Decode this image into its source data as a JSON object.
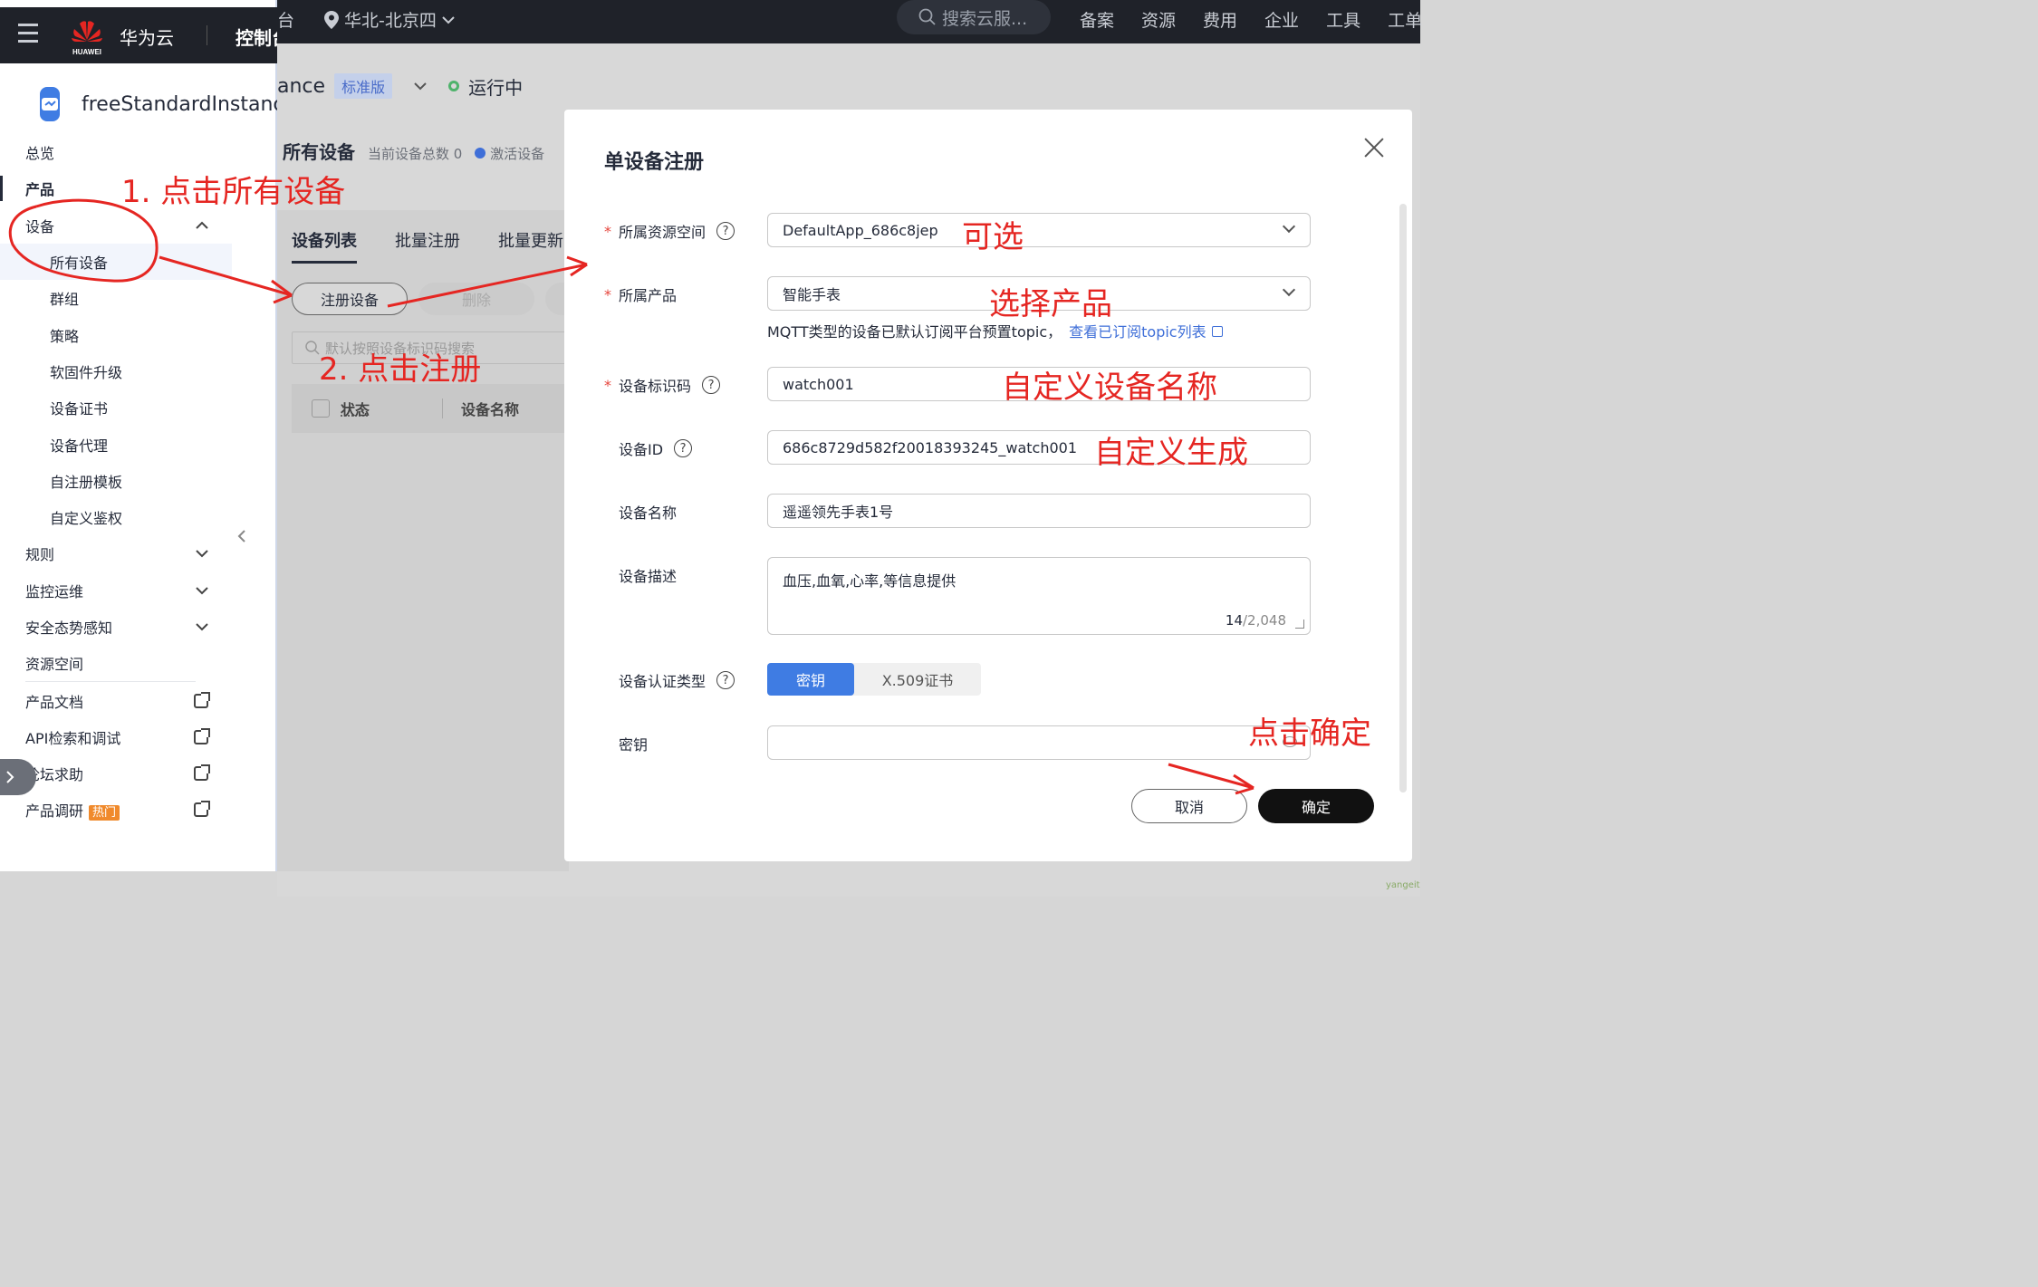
{
  "topbar": {
    "partial_left": "台",
    "region": "华北-北京四",
    "search_placeholder": "搜索云服...",
    "nav": [
      "备案",
      "资源",
      "费用",
      "企业",
      "工具",
      "工单"
    ]
  },
  "left_panel": {
    "brand": "华为云",
    "logo_text": "HUAWEI",
    "console": "控制台",
    "instance_name": "freeStandardInstance",
    "menu": [
      {
        "label": "总览"
      },
      {
        "label": "产品"
      },
      {
        "label": "设备"
      },
      {
        "label": "所有设备"
      },
      {
        "label": "群组"
      },
      {
        "label": "策略"
      },
      {
        "label": "软固件升级"
      },
      {
        "label": "设备证书"
      },
      {
        "label": "设备代理"
      },
      {
        "label": "自注册模板"
      },
      {
        "label": "自定义鉴权"
      },
      {
        "label": "规则"
      },
      {
        "label": "监控运维"
      },
      {
        "label": "安全态势感知"
      },
      {
        "label": "资源空间"
      },
      {
        "label": "产品文档"
      },
      {
        "label": "API检索和调试"
      },
      {
        "label": "论坛求助"
      },
      {
        "label": "产品调研",
        "badge": "热门"
      }
    ]
  },
  "background": {
    "instance_partial": "ance",
    "edition_tag": "标准版",
    "status": "运行中",
    "page_title": "所有设备",
    "device_total": "当前设备总数 0",
    "activated": "激活设备",
    "tabs": [
      "设备列表",
      "批量注册",
      "批量更新"
    ],
    "register_button": "注册设备",
    "delete_button": "删除",
    "search_placeholder": "默认按照设备标识码搜索",
    "table_headers": [
      "状态",
      "设备名称"
    ]
  },
  "modal": {
    "title": "单设备注册",
    "fields": {
      "resource_space": {
        "label": "所属资源空间",
        "value": "DefaultApp_686c8jep"
      },
      "product": {
        "label": "所属产品",
        "value": "智能手表"
      },
      "hint": "MQTT类型的设备已默认订阅平台预置topic，",
      "hint_link": "查看已订阅topic列表",
      "node_id": {
        "label": "设备标识码",
        "value": "watch001"
      },
      "device_id": {
        "label": "设备ID",
        "value": "686c8729d582f20018393245_watch001"
      },
      "device_name": {
        "label": "设备名称",
        "value": "遥遥领先手表1号"
      },
      "description": {
        "label": "设备描述",
        "value": "血压,血氧,心率,等信息提供",
        "count": "14",
        "max": "/2,048"
      },
      "auth_type": {
        "label": "设备认证类型",
        "options": [
          "密钥",
          "X.509证书"
        ],
        "selected": "密钥"
      },
      "secret": {
        "label": "密钥",
        "value": ""
      }
    },
    "cancel_button": "取消",
    "ok_button": "确定"
  },
  "annotations": {
    "step1": "1. 点击所有设备",
    "step2": "2. 点击注册",
    "optional": "可选",
    "choose_product": "选择产品",
    "custom_name": "自定义设备名称",
    "auto_generate": "自定义生成",
    "click_ok": "点击确定"
  },
  "watermark": "yangeit",
  "colors": {
    "accent": "#3f7ce3",
    "annotation": "#e52622",
    "topbar": "#1f2229",
    "status_ok": "#4eb36b",
    "hot_badge": "#f08a2c"
  }
}
